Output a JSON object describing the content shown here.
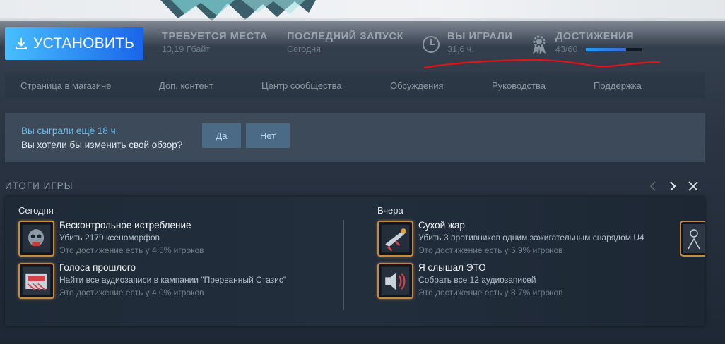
{
  "header": {
    "install_label": "УСТАНОВИТЬ",
    "stats": [
      {
        "title": "ТРЕБУЕТСЯ МЕСТА",
        "value": "13,19 Гбайт"
      },
      {
        "title": "ПОСЛЕДНИЙ ЗАПУСК",
        "value": "Сегодня"
      },
      {
        "title": "ВЫ ИГРАЛИ",
        "value": "31,6 ч.",
        "icon": "clock-icon"
      },
      {
        "title": "ДОСТИЖЕНИЯ",
        "value": "43/60",
        "icon": "achievement-gear-icon",
        "progress": 0.717
      }
    ],
    "accent_color": "#1a9fff"
  },
  "subnav": {
    "items": [
      "Страница в магазине",
      "Доп. контент",
      "Центр сообщества",
      "Обсуждения",
      "Руководства",
      "Поддержка"
    ]
  },
  "review": {
    "line1": "Вы сыграли ещё 18 ч.",
    "line2": "Вы хотели бы изменить свой обзор?",
    "yes": "Да",
    "no": "Нет"
  },
  "summary": {
    "title": "ИТОГИ ИГРЫ",
    "days": [
      {
        "label": "Сегодня",
        "achievements": [
          {
            "name": "Бесконтрольное истребление",
            "desc": "Убить 2179 ксеноморфов",
            "pct": "Это достижение есть у 4.5% игроков"
          },
          {
            "name": "Голоса прошлого",
            "desc": "Найти все аудиозаписи в кампании \"Прерванный Стазис\"",
            "pct": "Это достижение есть у 4.0% игроков"
          }
        ]
      },
      {
        "label": "Вчера",
        "achievements": [
          {
            "name": "Сухой жар",
            "desc": "Убить 3 противников одним зажигательным снарядом U4",
            "pct": "Это достижение есть у 5.9% игроков"
          },
          {
            "name": "Я слышал ЭТО",
            "desc": "Собрать все 12 аудиозаписей",
            "pct": "Это достижение есть у 8.7% игроков"
          }
        ]
      }
    ]
  }
}
